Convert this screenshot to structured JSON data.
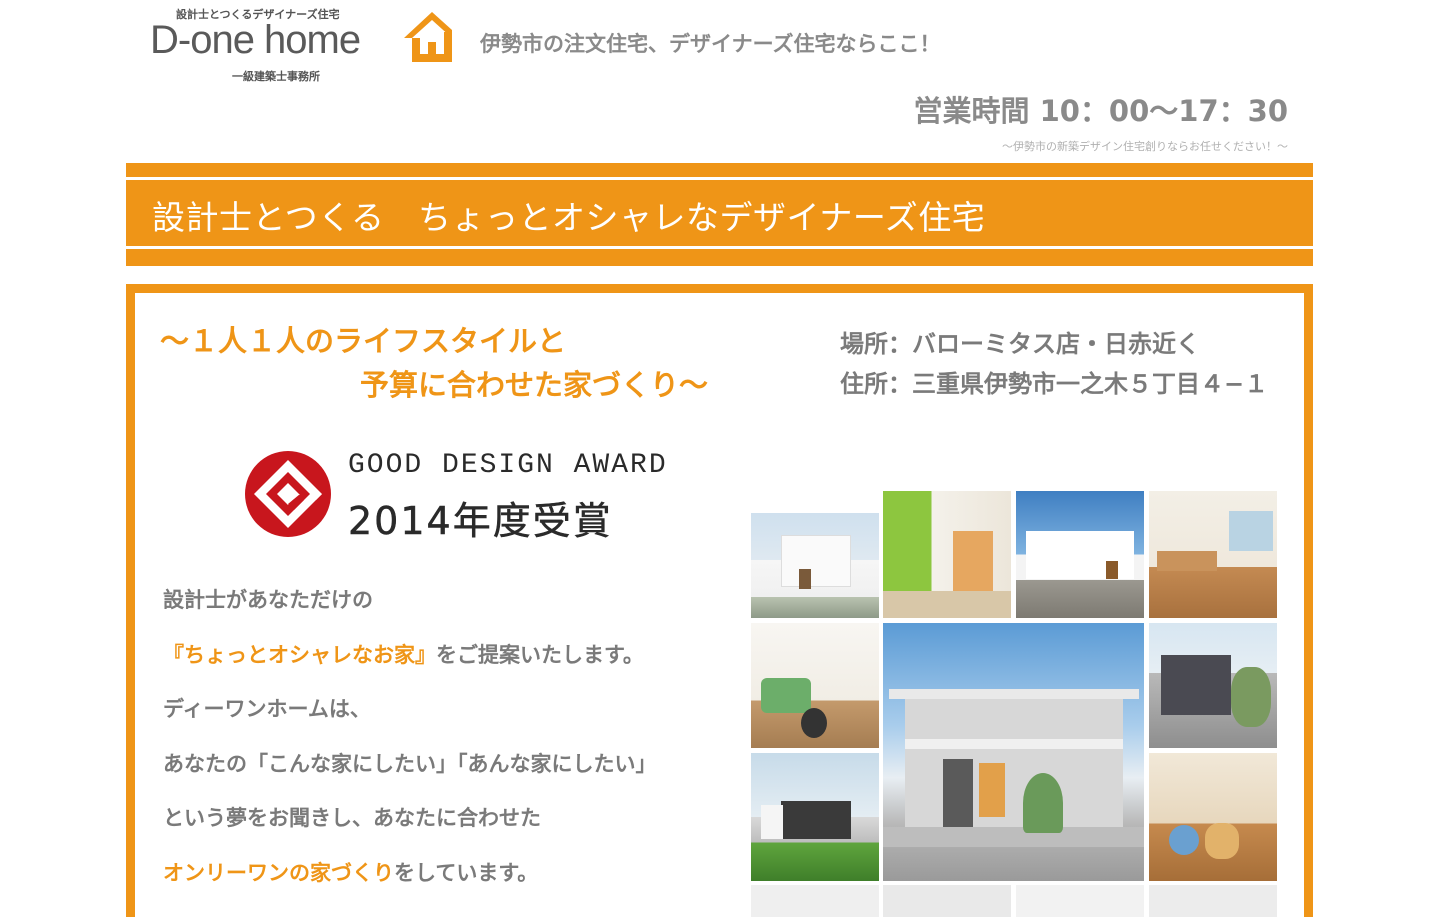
{
  "header": {
    "logo_tagline": "設計士とつくるデザイナーズ住宅",
    "logo_name": "D-one home",
    "logo_sub": "一級建築士事務所",
    "slogan": "伊勢市の注文住宅、デザイナーズ住宅ならここ！",
    "hours": "営業時間 10：00〜17：30",
    "hours_sub": "〜伊勢市の新築デザイン住宅創りならお任せください！〜"
  },
  "banner": {
    "title": "設計士とつくる　ちょっとオシャレなデザイナーズ住宅"
  },
  "intro": {
    "headline_1": "〜１人１人のライフスタイルと",
    "headline_2": "予算に合わせた家づくり〜",
    "place": "場所：バローミタス店・日赤近く",
    "address": "住所：三重県伊勢市一之木５丁目４−１"
  },
  "award": {
    "line1": "GOOD DESIGN AWARD",
    "line2": "2014年度受賞"
  },
  "body": {
    "line1": "設計士があなただけの",
    "line2_highlight": "『ちょっとオシャレなお家』",
    "line2_rest": "をご提案いたします。",
    "line3": "ディーワンホームは、",
    "line4": "あなたの「こんな家にしたい」「あんな家にしたい」",
    "line5": "という夢をお聞きし、あなたに合わせた",
    "line6_highlight": "オンリーワンの家づくり",
    "line6_rest": "をしています。"
  },
  "colors": {
    "accent": "#ef9517",
    "text_gray": "#7a7a7a",
    "award_red": "#c8161d"
  },
  "icons": {
    "logo": "house-logo-icon",
    "award": "g-mark-icon"
  }
}
